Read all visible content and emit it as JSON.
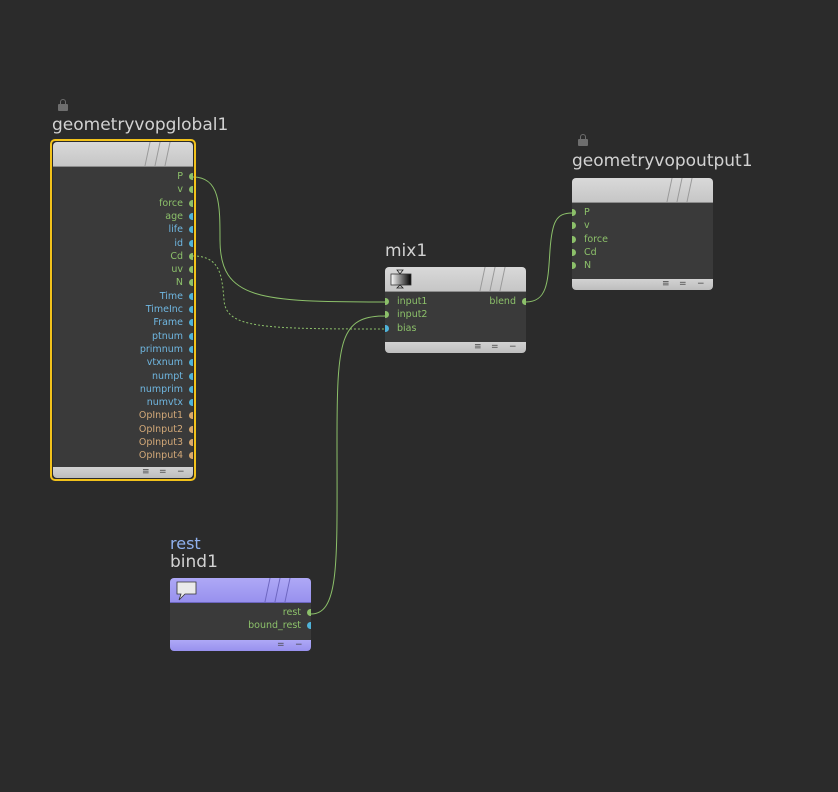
{
  "colors": {
    "background": "#2b2b2b",
    "wire": "#8cc06a",
    "float_port": "#8cc06a",
    "vector_port": "#8cc06a",
    "int_port": "#4fb3d9",
    "string_port": "#d9a86b",
    "selection": "#f2c21b",
    "bind_node": "#9f98f2"
  },
  "nodes": {
    "global": {
      "name": "geometryvopglobal1",
      "lock_icon": "lock-icon",
      "outputs": [
        {
          "label": "P",
          "color": "#8cc06a",
          "text_color": "#8cc06a"
        },
        {
          "label": "v",
          "color": "#8cc06a",
          "text_color": "#8cc06a"
        },
        {
          "label": "force",
          "color": "#8cc06a",
          "text_color": "#8cc06a"
        },
        {
          "label": "age",
          "color": "#4fb3d9",
          "text_color": "#8cc06a"
        },
        {
          "label": "life",
          "color": "#4fb3d9",
          "text_color": "#6fb6e0"
        },
        {
          "label": "id",
          "color": "#4fb3d9",
          "text_color": "#6fb6e0"
        },
        {
          "label": "Cd",
          "color": "#8cc06a",
          "text_color": "#8cc06a"
        },
        {
          "label": "uv",
          "color": "#8cc06a",
          "text_color": "#8cc06a"
        },
        {
          "label": "N",
          "color": "#8cc06a",
          "text_color": "#8cc06a"
        },
        {
          "label": "Time",
          "color": "#4fb3d9",
          "text_color": "#6fb6e0"
        },
        {
          "label": "TimeInc",
          "color": "#4fb3d9",
          "text_color": "#6fb6e0"
        },
        {
          "label": "Frame",
          "color": "#4fb3d9",
          "text_color": "#6fb6e0"
        },
        {
          "label": "ptnum",
          "color": "#4fb3d9",
          "text_color": "#6fb6e0"
        },
        {
          "label": "primnum",
          "color": "#4fb3d9",
          "text_color": "#6fb6e0"
        },
        {
          "label": "vtxnum",
          "color": "#4fb3d9",
          "text_color": "#6fb6e0"
        },
        {
          "label": "numpt",
          "color": "#4fb3d9",
          "text_color": "#6fb6e0"
        },
        {
          "label": "numprim",
          "color": "#4fb3d9",
          "text_color": "#6fb6e0"
        },
        {
          "label": "numvtx",
          "color": "#4fb3d9",
          "text_color": "#6fb6e0"
        },
        {
          "label": "OpInput1",
          "color": "#d9a86b",
          "text_color": "#d2a878"
        },
        {
          "label": "OpInput2",
          "color": "#d9a86b",
          "text_color": "#d2a878"
        },
        {
          "label": "OpInput3",
          "color": "#d9a86b",
          "text_color": "#d2a878"
        },
        {
          "label": "OpInput4",
          "color": "#d9a86b",
          "text_color": "#d2a878"
        }
      ]
    },
    "output": {
      "name": "geometryvopoutput1",
      "lock_icon": "lock-icon",
      "inputs": [
        {
          "label": "P",
          "color": "#8cc06a"
        },
        {
          "label": "v",
          "color": "#8cc06a"
        },
        {
          "label": "force",
          "color": "#8cc06a"
        },
        {
          "label": "Cd",
          "color": "#8cc06a"
        },
        {
          "label": "N",
          "color": "#8cc06a"
        }
      ]
    },
    "mix": {
      "name": "mix1",
      "icon": "mix-gradient-icon",
      "inputs": [
        {
          "label": "input1",
          "color": "#8cc06a"
        },
        {
          "label": "input2",
          "color": "#8cc06a"
        },
        {
          "label": "bias",
          "color": "#4fb3d9"
        }
      ],
      "outputs": [
        {
          "label": "blend",
          "color": "#8cc06a"
        }
      ]
    },
    "bind": {
      "name": "bind1",
      "comment": "rest",
      "icon": "speech-bubble-icon",
      "outputs": [
        {
          "label": "rest",
          "color": "#8cc06a"
        },
        {
          "label": "bound_rest",
          "color": "#4fb3d9"
        }
      ]
    }
  },
  "footer_icons": {
    "menu": "≡",
    "equal": "=",
    "minus": "−"
  }
}
